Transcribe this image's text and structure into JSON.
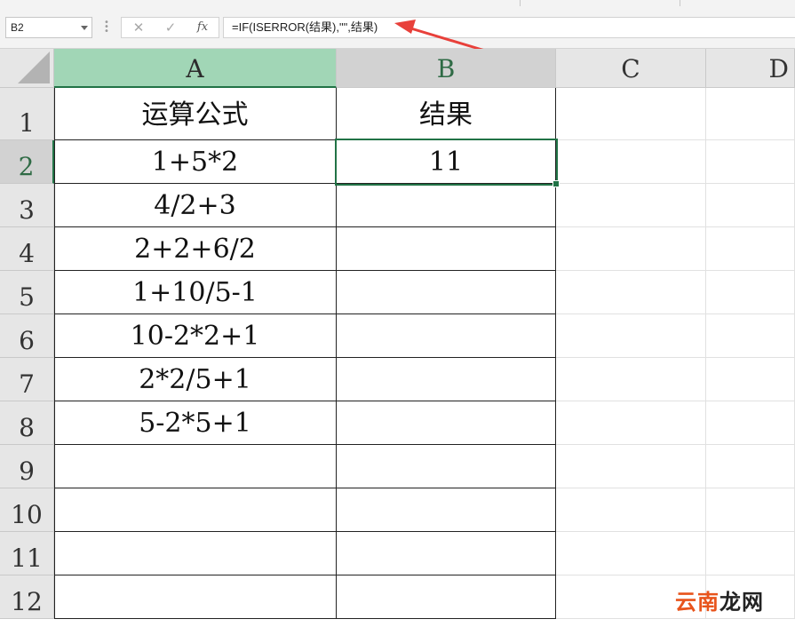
{
  "name_box": {
    "value": "B2"
  },
  "formula_bar": {
    "cancel_icon": "close-icon",
    "enter_icon": "check-icon",
    "fx_label": "fx",
    "formula": "=IF(ISERROR(结果),\"\",结果)"
  },
  "columns": [
    "A",
    "B",
    "C",
    "D"
  ],
  "rows": [
    "1",
    "2",
    "3",
    "4",
    "5",
    "6",
    "7",
    "8",
    "9",
    "10",
    "11",
    "12"
  ],
  "table": {
    "header": [
      "运算公式",
      "结果"
    ],
    "rows": [
      [
        "1+5*2",
        "11"
      ],
      [
        "4/2+3",
        ""
      ],
      [
        "2+2+6/2",
        ""
      ],
      [
        "1+10/5-1",
        ""
      ],
      [
        "10-2*2+1",
        ""
      ],
      [
        "2*2/5+1",
        ""
      ],
      [
        "5-2*5+1",
        ""
      ]
    ]
  },
  "selection": {
    "cell": "B2",
    "active_column": "B",
    "active_row": "2"
  },
  "annotation": {
    "arrow_color": "#e8403a"
  },
  "watermark": {
    "part1": "云南",
    "part2": "龙网"
  },
  "colors": {
    "accent": "#217346",
    "column_a_highlight": "#a1d6b6"
  }
}
